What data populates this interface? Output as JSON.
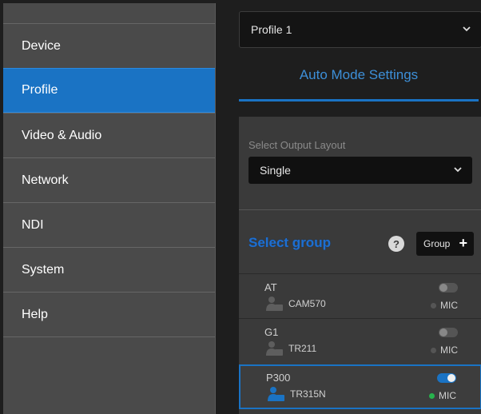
{
  "sidebar": {
    "items": [
      {
        "label": "Device"
      },
      {
        "label": "Profile",
        "active": true
      },
      {
        "label": "Video & Audio"
      },
      {
        "label": "Network"
      },
      {
        "label": "NDI"
      },
      {
        "label": "System"
      },
      {
        "label": "Help"
      }
    ]
  },
  "profile_select": {
    "value": "Profile 1"
  },
  "mode": {
    "title": "Auto Mode Settings"
  },
  "layout": {
    "label": "Select Output Layout",
    "value": "Single"
  },
  "groups": {
    "title": "Select group",
    "help_symbol": "?",
    "button_label": "Group",
    "button_symbol": "+",
    "rows": [
      {
        "name": "AT",
        "camera": "CAM570",
        "enabled": false,
        "mic_label": "MIC",
        "mic_active": false
      },
      {
        "name": "G1",
        "camera": "TR211",
        "enabled": false,
        "mic_label": "MIC",
        "mic_active": false
      },
      {
        "name": "P300",
        "camera": "TR315N",
        "enabled": true,
        "mic_label": "MIC",
        "mic_active": true,
        "selected": true
      }
    ]
  },
  "colors": {
    "accent": "#1a73c4",
    "mic_active": "#27b34d",
    "sidebar_bg": "#4a4a4a"
  }
}
